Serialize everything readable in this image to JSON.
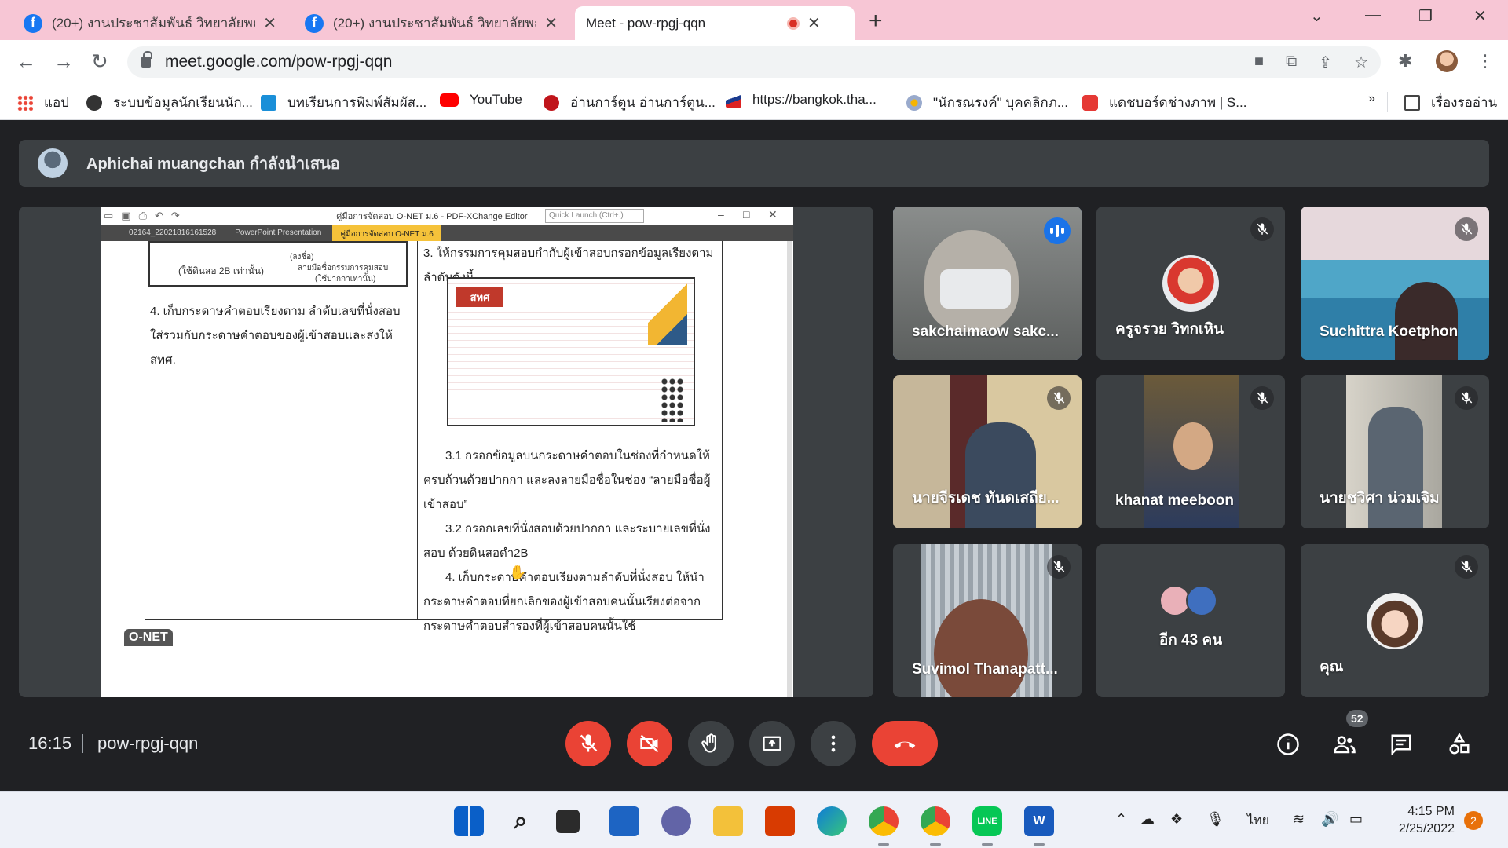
{
  "browser": {
    "tabs": [
      {
        "title": "(20+) งานประชาสัมพันธ์ วิทยาลัยพณิ",
        "favicon": "facebook-icon"
      },
      {
        "title": "(20+) งานประชาสัมพันธ์ วิทยาลัยพณิ",
        "favicon": "facebook-icon"
      },
      {
        "title": "Meet - pow-rpgj-qqn",
        "favicon": "google-meet-icon",
        "recording": true
      }
    ],
    "url": "meet.google.com/pow-rpgj-qqn",
    "bookmarks": [
      {
        "label": "แอป",
        "icon": "apps-grid-icon"
      },
      {
        "label": "ระบบข้อมูลนักเรียนนัก...",
        "icon": "globe-icon"
      },
      {
        "label": "บทเรียนการพิมพ์สัมผัส...",
        "icon": "ts-icon"
      },
      {
        "label": "YouTube",
        "icon": "youtube-icon"
      },
      {
        "label": "อ่านการ์ตูน อ่านการ์ตูน...",
        "icon": "manga-icon"
      },
      {
        "label": "https://bangkok.tha...",
        "icon": "flag-icon"
      },
      {
        "label": "\"นักรณรงค์\" บุคคลิกภ...",
        "icon": "sun-icon"
      },
      {
        "label": "แดชบอร์ดช่างภาพ | S...",
        "icon": "red-logo-icon"
      }
    ],
    "reading_list": "เรื่องรออ่าน"
  },
  "meet": {
    "presenter_text": "Aphichai muangchan กำลังนำเสนอ",
    "time": "16:15",
    "meeting_code": "pow-rpgj-qqn",
    "participants_count": "52",
    "shared_screen": {
      "window_title": "คู่มือการจัดสอบ O-NET ม.6 - PDF-XChange Editor",
      "quick_launch": "Quick Launch (Ctrl+.)",
      "tabs": [
        "02164_22021816161528",
        "PowerPoint Presentation",
        "คู่มือการจัดสอบ O-NET ม.6"
      ],
      "left_box_labels": [
        "(ใช้ดินสอ 2B เท่านั้น)",
        "(ลงชื่อ)",
        "ลายมือชื่อกรรมการคุมสอบ",
        "(ใช้ปากกาเท่านั้น)"
      ],
      "left_text": "4.  เก็บกระดาษคำตอบเรียงตาม ลำดับเลขที่นั่งสอบ ใส่รวมกับกระดาษคำตอบของผู้เข้าสอบและส่งให้ สทศ.",
      "right_top": "3.  ให้กรรมการคุมสอบกำกับผู้เข้าสอบกรอกข้อมูลเรียงตามลำดับดังนี้",
      "form_logo": "สทศ",
      "right_items": [
        "3.1  กรอกข้อมูลบนกระดาษคำตอบในช่องที่กำหนดให้ครบถ้วนด้วยปากกา และลงลายมือชื่อในช่อง “ลายมือชื่อผู้เข้าสอบ”",
        "3.2  กรอกเลขที่นั่งสอบด้วยปากกา และระบายเลขที่นั่งสอบ ด้วยดินสอดำ2B",
        "4.  เก็บกระดาษคำตอบเรียงตามลำดับที่นั่งสอบ ให้นำกระดาษคำตอบที่ยกเลิกของผู้เข้าสอบคนนั้นเรียงต่อจากกระดาษคำตอบสำรองที่ผู้เข้าสอบคนนั้นใช้"
      ],
      "badge": "O-NET"
    },
    "tiles": [
      {
        "name": "sakchaimaow sakc...",
        "state": "speaking"
      },
      {
        "name": "ครูจรวย วิทกเหิน",
        "state": "muted"
      },
      {
        "name": "Suchittra Koetphon",
        "state": "muted"
      },
      {
        "name": "นายจีรเดช ทันดเสถีย...",
        "state": "muted"
      },
      {
        "name": "khanat meeboon",
        "state": "muted"
      },
      {
        "name": "นายชวิศา น่วมเจิม",
        "state": "muted"
      },
      {
        "name": "Suvimol Thanapatt...",
        "state": "muted"
      },
      {
        "name": "อีก 43 คน",
        "state": "others"
      },
      {
        "name": "คุณ",
        "state": "muted"
      }
    ]
  },
  "taskbar": {
    "lang": "ไทย",
    "time": "4:15 PM",
    "date": "2/25/2022",
    "notifications": "2"
  }
}
